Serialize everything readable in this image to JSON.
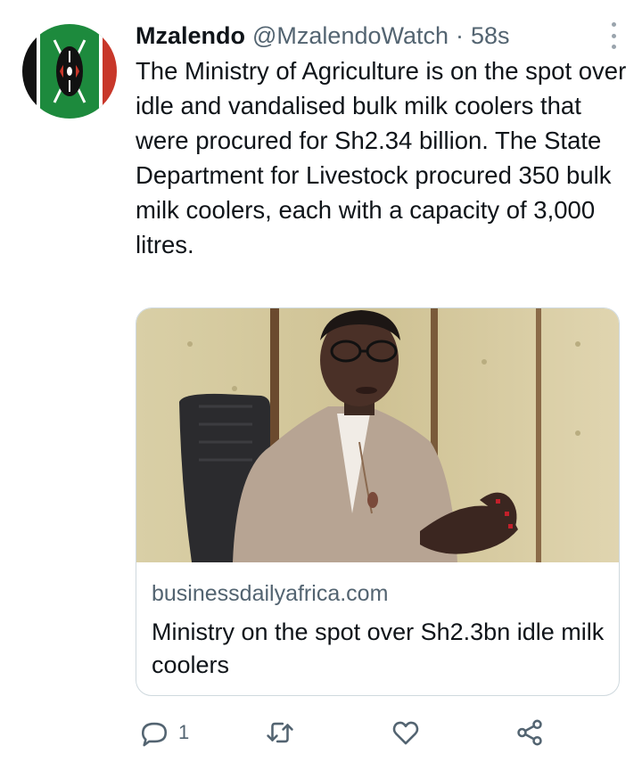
{
  "tweet": {
    "author_name": "Mzalendo",
    "handle": "@MzalendoWatch",
    "separator": "·",
    "time": "58s",
    "text": "The Ministry of Agriculture is on the spot over idle and vandalised bulk milk coolers that were procured for Sh2.34 billion. The State Department for Livestock procured 350 bulk milk coolers, each with a capacity of 3,000 litres."
  },
  "card": {
    "domain": "businessdailyafrica.com",
    "title": "Ministry on the spot over Sh2.3bn idle milk coolers"
  },
  "actions": {
    "reply_count": "1"
  },
  "icons": {
    "avatar": "kenya-flag-shield-icon",
    "more": "more-vertical-icon",
    "reply": "reply-icon",
    "retweet": "retweet-icon",
    "like": "heart-icon",
    "share": "share-icon"
  },
  "colors": {
    "text": "#0f1419",
    "secondary": "#536471",
    "card_border": "#cfd9de"
  }
}
